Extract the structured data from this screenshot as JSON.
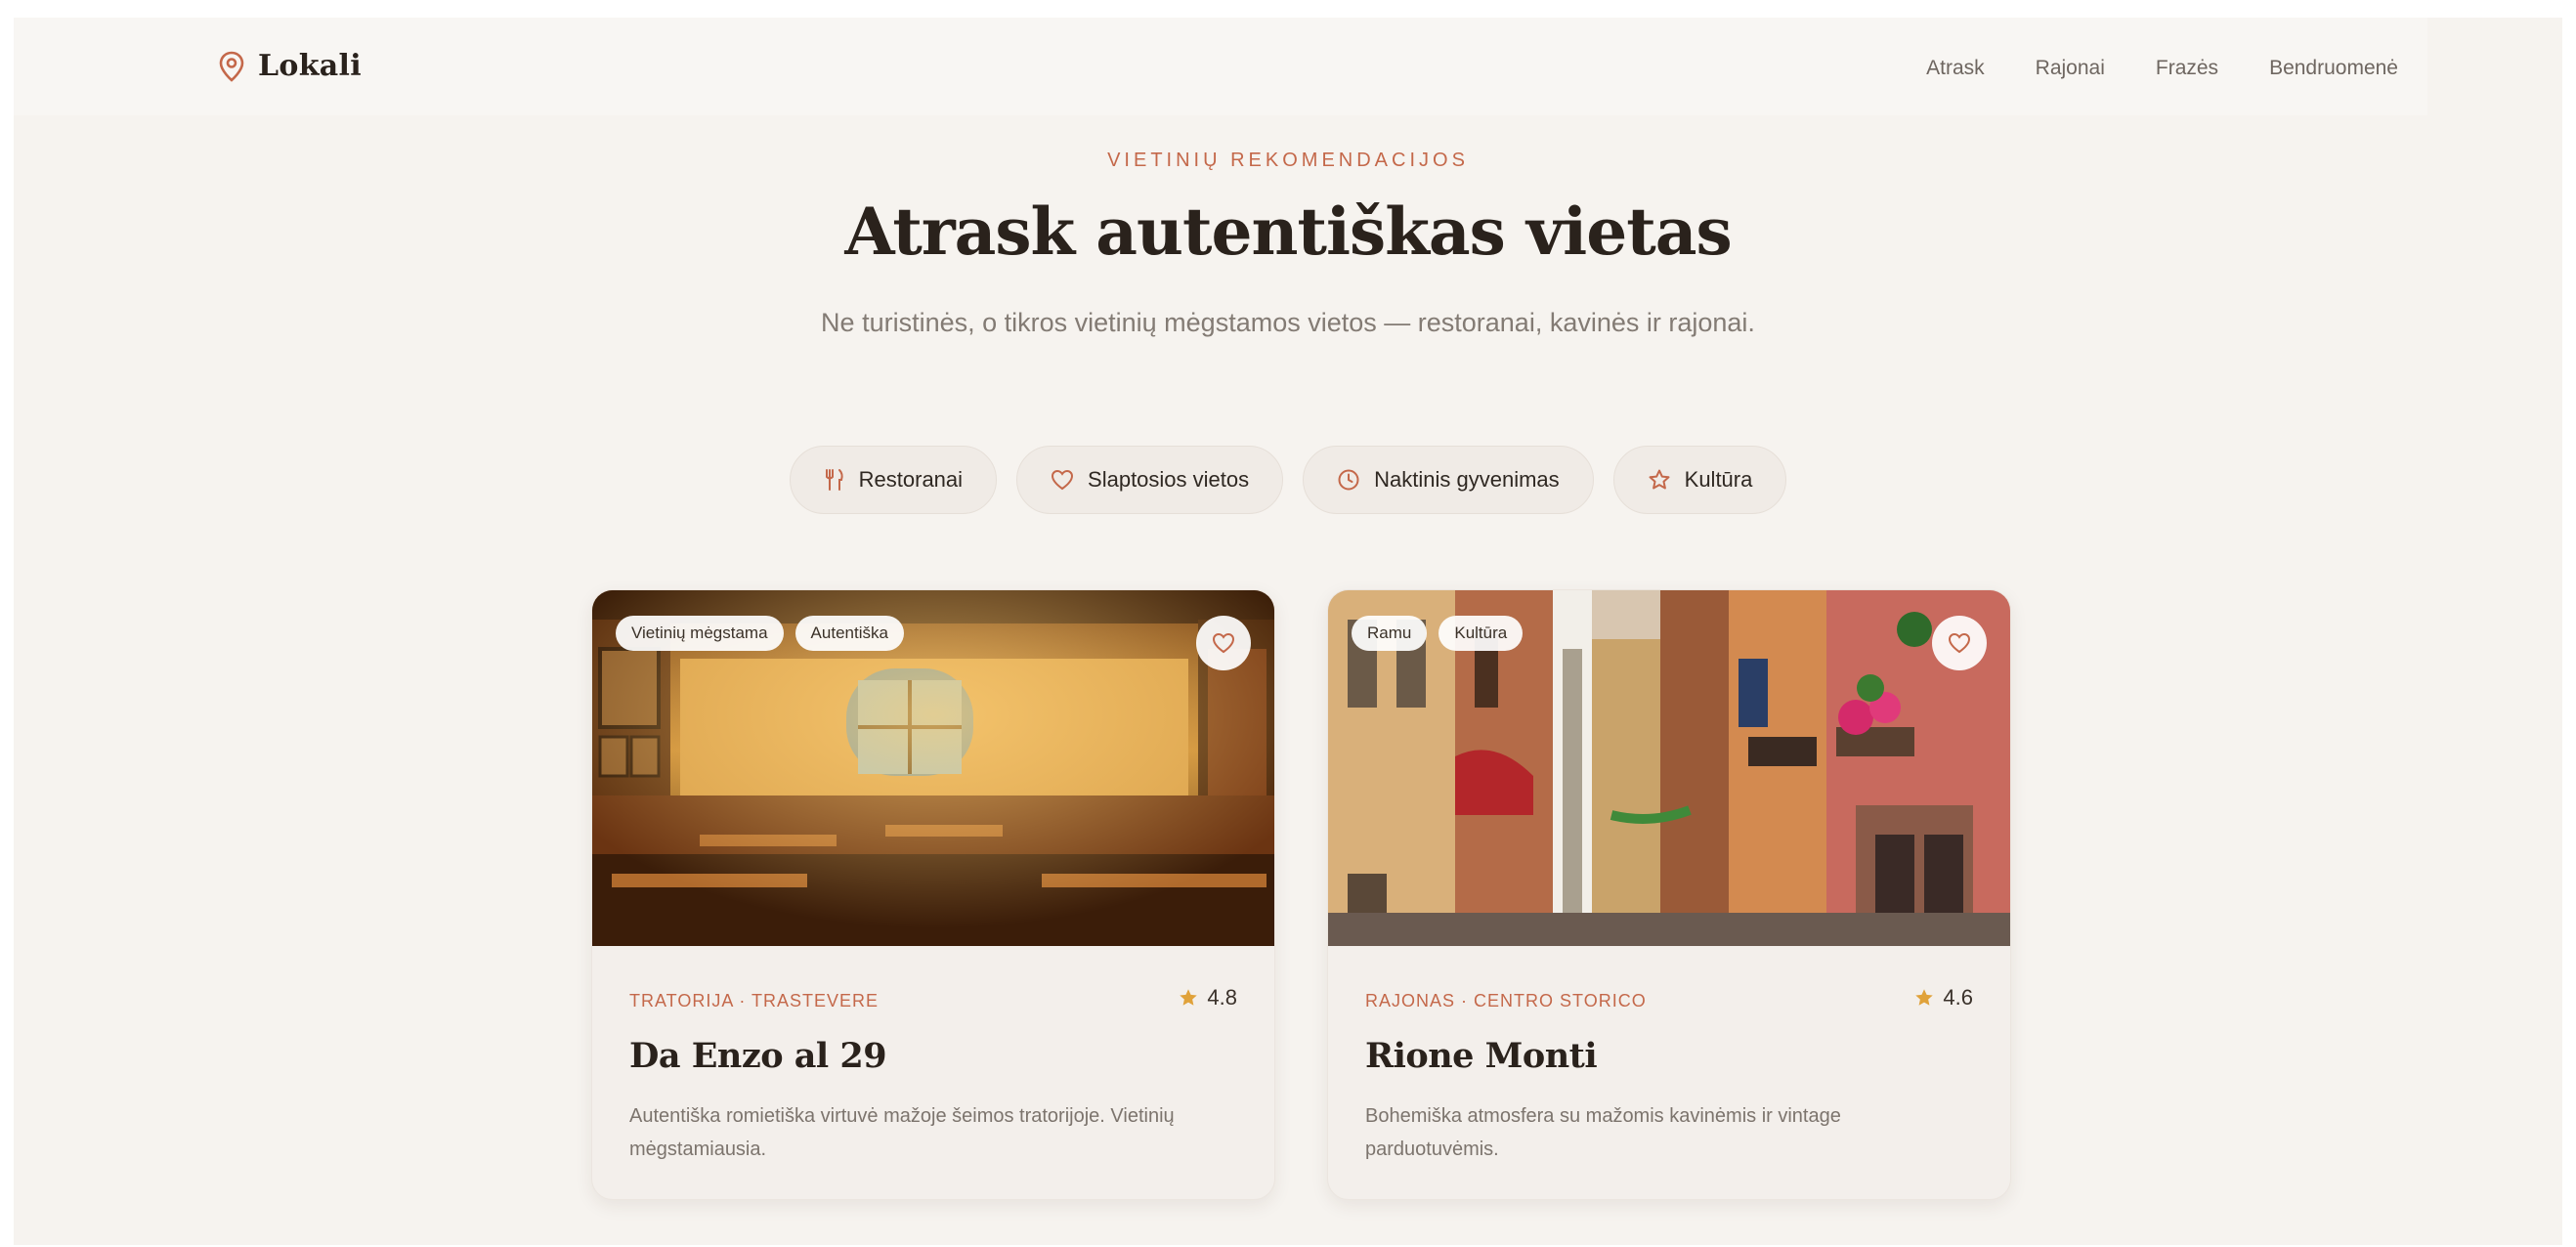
{
  "header": {
    "brand": "Lokali",
    "nav": [
      "Atrask",
      "Rajonai",
      "Frazės",
      "Bendruomenė"
    ]
  },
  "hero": {
    "kicker": "VIETINIŲ REKOMENDACIJOS",
    "title": "Atrask autentiškas vietas",
    "subtitle": "Ne turistinės, o tikros vietinių mėgstamos vietos — restoranai, kavinės ir rajonai."
  },
  "filters": [
    {
      "label": "Restoranai",
      "icon": "utensils-icon"
    },
    {
      "label": "Slaptosios vietos",
      "icon": "heart-icon"
    },
    {
      "label": "Naktinis gyvenimas",
      "icon": "clock-icon"
    },
    {
      "label": "Kultūra",
      "icon": "star-icon"
    }
  ],
  "cards": [
    {
      "tags": [
        "Vietinių mėgstama",
        "Autentiška"
      ],
      "meta": "TRATORIJA · TRASTEVERE",
      "rating": "4.8",
      "title": "Da Enzo al 29",
      "description": "Autentiška romietiška virtuvė mažoje šeimos tratorijoje. Vietinių mėgstamiausia."
    },
    {
      "tags": [
        "Ramu",
        "Kultūra"
      ],
      "meta": "RAJONAS · CENTRO STORICO",
      "rating": "4.6",
      "title": "Rione Monti",
      "description": "Bohemiška atmosfera su mažomis kavinėmis ir vintage parduotuvėmis."
    }
  ],
  "colors": {
    "accent": "#c4684a",
    "background": "#f6f3ef",
    "star": "#e0a23a"
  }
}
